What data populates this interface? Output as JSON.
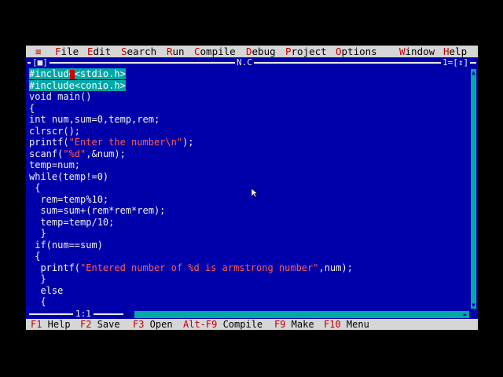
{
  "menubar": {
    "system": "≡",
    "items": [
      {
        "hot": "F",
        "rest": "ile"
      },
      {
        "hot": "E",
        "rest": "dit"
      },
      {
        "hot": "S",
        "rest": "earch"
      },
      {
        "hot": "R",
        "rest": "un"
      },
      {
        "hot": "C",
        "rest": "ompile"
      },
      {
        "hot": "D",
        "rest": "ebug"
      },
      {
        "hot": "P",
        "rest": "roject"
      },
      {
        "hot": "O",
        "rest": "ptions"
      },
      {
        "hot": "W",
        "rest": "indow"
      },
      {
        "hot": "H",
        "rest": "elp"
      }
    ]
  },
  "window": {
    "close_box": "[■]",
    "title": "N.C",
    "number": "1=[↕]"
  },
  "code": [
    "#include<stdio.h>",
    "#include<conio.h>",
    "void main()",
    "{",
    "int num,sum=0,temp,rem;",
    "clrscr();",
    [
      "printf(",
      "\"Enter the number\\n\"",
      ");"
    ],
    [
      "scanf(",
      "\"%d\"",
      ",&num);"
    ],
    "temp=num;",
    "while(temp!=0)",
    " {",
    "  rem=temp%10;",
    "  sum=sum+(rem*rem*rem);",
    "  temp=temp/10;",
    "  }",
    " if(num==sum)",
    " {",
    [
      "  printf(",
      "\"Entered number of %d is armstrong number\"",
      ",num);"
    ],
    "  }",
    "  else",
    "  {"
  ],
  "cursor_position": "1:1",
  "statusbar": [
    {
      "key": "F1",
      "label": " Help"
    },
    {
      "key": "F2",
      "label": " Save"
    },
    {
      "key": "F3",
      "label": " Open"
    },
    {
      "key": "Alt-F9",
      "label": " Compile"
    },
    {
      "key": "F9",
      "label": " Make"
    },
    {
      "key": "F10",
      "label": " Menu"
    }
  ],
  "colors": {
    "editor_bg": "#0000aa",
    "menu_bg": "#d6d6d6",
    "hotkey": "#c00000",
    "string": "#ff5a5a",
    "selection": "#00a8a8"
  },
  "icons": {
    "mouse_pointer": "mouse-pointer-icon"
  }
}
